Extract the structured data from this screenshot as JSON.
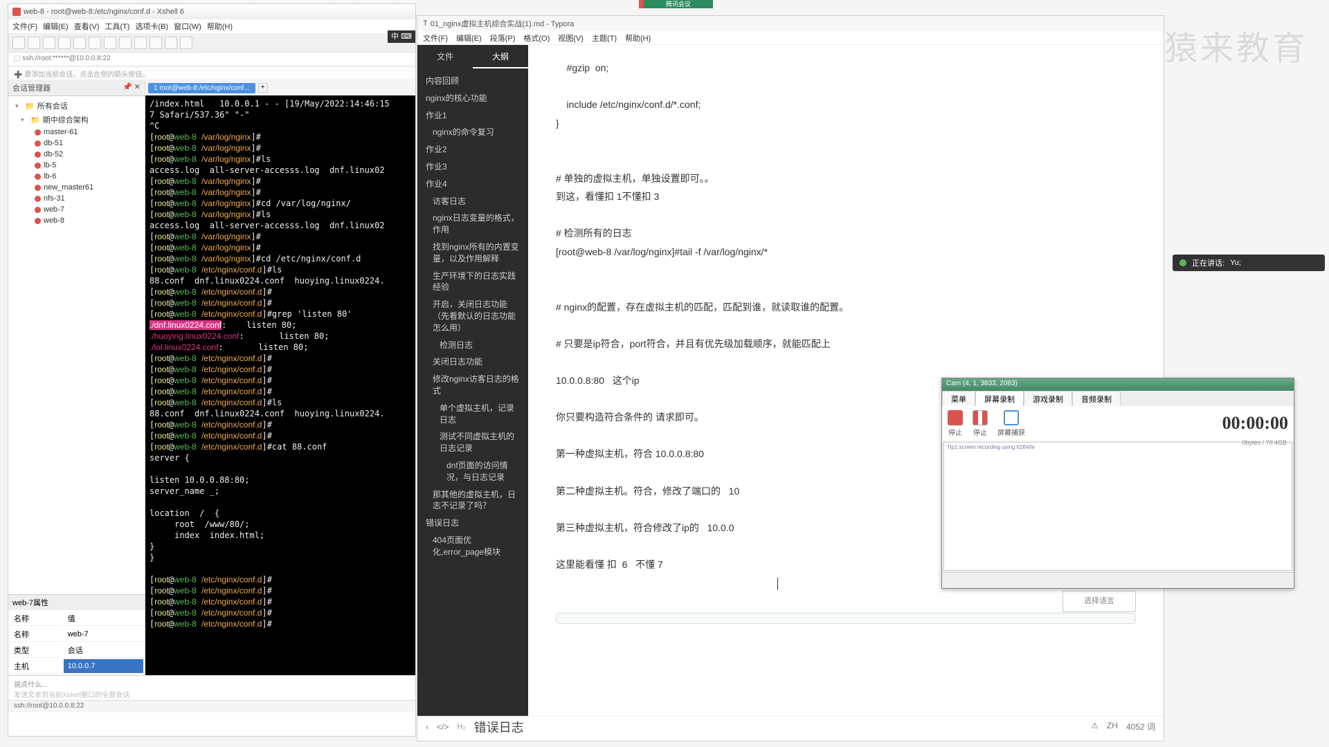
{
  "conference": {
    "label": "腾讯会议"
  },
  "watermark": "猿来教育",
  "speaking": {
    "prefix": "正在讲话:",
    "name": "Yu;"
  },
  "ime": "中 ⌨",
  "xshell": {
    "title": "web-8 - root@web-8:/etc/nginx/conf.d - Xshell 6",
    "menu": [
      "文件(F)",
      "编辑(E)",
      "查看(V)",
      "工具(T)",
      "选项卡(B)",
      "窗口(W)",
      "帮助(H)"
    ],
    "ssh_line": "⬚ ssh://root:******@10.0.0.8:22",
    "tip": "➕ 要添加当前会话，点击左侧的箭头按钮。",
    "session_mgr": "会话管理器",
    "tree": {
      "root": "所有会话",
      "folder": "期中综合架构",
      "items": [
        "master-61",
        "db-51",
        "db-52",
        "lb-5",
        "lb-6",
        "new_master61",
        "nfs-31",
        "web-7",
        "web-8"
      ]
    },
    "props": {
      "title": "web-7属性",
      "h_name": "名称",
      "h_val": "值",
      "r1k": "名称",
      "r1v": "web-7",
      "r2k": "类型",
      "r2v": "会话",
      "r3k": "主机",
      "r3v": "10.0.0.7"
    },
    "tab": "1 root@web-8:/etc/nginx/conf...",
    "terminal": "/index.html   10.0.0.1 - - [19/May/2022:14:46:15\n7 Safari/537.36\" \"-\"\n^C\n[root@web-8 /var/log/nginx]#\n[root@web-8 /var/log/nginx]#\n[root@web-8 /var/log/nginx]#ls\naccess.log  all-server-accesss.log  dnf.linux02\n[root@web-8 /var/log/nginx]#\n[root@web-8 /var/log/nginx]#\n[root@web-8 /var/log/nginx]#cd /var/log/nginx/\n[root@web-8 /var/log/nginx]#ls\naccess.log  all-server-accesss.log  dnf.linux02\n[root@web-8 /var/log/nginx]#\n[root@web-8 /var/log/nginx]#\n[root@web-8 /var/log/nginx]#cd /etc/nginx/conf.d\n[root@web-8 /etc/nginx/conf.d]#ls\n88.conf  dnf.linux0224.conf  huoying.linux0224.\n[root@web-8 /etc/nginx/conf.d]#\n[root@web-8 /etc/nginx/conf.d]#\n[root@web-8 /etc/nginx/conf.d]#grep 'listen 80'\n./dnf.linux0224.conf:    listen 80;\n./huoying.linux0224.conf:       listen 80;\n./lol.linux0224.conf:       listen 80;\n[root@web-8 /etc/nginx/conf.d]#\n[root@web-8 /etc/nginx/conf.d]#\n[root@web-8 /etc/nginx/conf.d]#\n[root@web-8 /etc/nginx/conf.d]#\n[root@web-8 /etc/nginx/conf.d]#ls\n88.conf  dnf.linux0224.conf  huoying.linux0224.\n[root@web-8 /etc/nginx/conf.d]#\n[root@web-8 /etc/nginx/conf.d]#\n[root@web-8 /etc/nginx/conf.d]#cat 88.conf\nserver {\n\nlisten 10.0.0.88:80;\nserver_name _;\n\nlocation  /  {\n     root  /www/80/;\n     index  index.html;\n}\n}\n\n[root@web-8 /etc/nginx/conf.d]#\n[root@web-8 /etc/nginx/conf.d]#\n[root@web-8 /etc/nginx/conf.d]#\n[root@web-8 /etc/nginx/conf.d]#\n[root@web-8 /etc/nginx/conf.d]#",
    "bot_hint": "说点什么...",
    "bot_note": "发送文本到当前Xshell窗口的全部会话",
    "status": "ssh://root@10.0.0.8:22"
  },
  "typora": {
    "title": "01_nginx虚拟主机综合实战(1).md - Typora",
    "menu": [
      "文件(F)",
      "编辑(E)",
      "段落(P)",
      "格式(O)",
      "视图(V)",
      "主题(T)",
      "帮助(H)"
    ],
    "side_tabs": {
      "file": "文件",
      "outline": "大纲"
    },
    "outline": [
      {
        "l": "l1",
        "t": "内容回顾"
      },
      {
        "l": "l1",
        "t": "nginx的核心功能"
      },
      {
        "l": "l1",
        "t": "作业1"
      },
      {
        "l": "l2",
        "t": "nginx的命令复习"
      },
      {
        "l": "l1",
        "t": "作业2"
      },
      {
        "l": "l1",
        "t": "作业3"
      },
      {
        "l": "l1",
        "t": "作业4"
      },
      {
        "l": "l2",
        "t": "访客日志"
      },
      {
        "l": "l2",
        "t": "nginx日志变量的格式，作用"
      },
      {
        "l": "l2",
        "t": "找到nginx所有的内置变量，以及作用解释"
      },
      {
        "l": "l2",
        "t": "生产环境下的日志实践经验"
      },
      {
        "l": "l2",
        "t": "开启，关闭日志功能（先看默认的日志功能怎么用）"
      },
      {
        "l": "l3",
        "t": "检测日志"
      },
      {
        "l": "l2",
        "t": "关闭日志功能"
      },
      {
        "l": "l2",
        "t": "修改nginx访客日志的格式"
      },
      {
        "l": "l3",
        "t": "单个虚拟主机，记录日志"
      },
      {
        "l": "l3",
        "t": "测试不同虚拟主机的日志记录"
      },
      {
        "l": "l4",
        "t": "dnf页面的访问情况，与日志记录"
      },
      {
        "l": "l2",
        "t": "那其他的虚拟主机，日志不记录了吗？"
      },
      {
        "l": "l1",
        "t": "错误日志"
      },
      {
        "l": "l2",
        "t": "404页面优化,error_page模块"
      }
    ],
    "content": {
      "l1": "    #gzip  on;",
      "l2": "    include /etc/nginx/conf.d/*.conf;",
      "l3": "}",
      "l4": "# 单独的虚拟主机，单独设置即可。。",
      "l5": "到这，看懂扣 1不懂扣 3",
      "l6": "# 检测所有的日志",
      "l7": "[root@web-8 /var/log/nginx]#tail -f /var/log/nginx/*",
      "l8": "# nginx的配置，存在虚拟主机的匹配，匹配到谁，就读取谁的配置。",
      "l9": "# 只要是ip符合，port符合，并且有优先级加载顺序，就能匹配上",
      "l10": "10.0.0.8:80   这个ip",
      "l11": "你只要构造符合条件的 请求即可。",
      "l12": "第一种虚拟主机，符合 10.0.0.8:80",
      "l13": "第二种虚拟主机。符合，修改了端口的   10",
      "l14": "第三种虚拟主机，符合修改了ip的   10.0.0",
      "l15": "这里能看懂 扣  6   不懂 7"
    },
    "lang_placeholder": "选择语言",
    "foot": {
      "h2": "H₂",
      "title": "错误日志",
      "warn": "⚠",
      "zh": "ZH",
      "count": "4052 词"
    }
  },
  "ocam": {
    "title": "Cam (4, 1, 3833, 2083)",
    "tabs": [
      "菜单",
      "屏幕录制",
      "游戏录制",
      "音频录制"
    ],
    "btns": {
      "stop": "停止",
      "pause": "停止",
      "capture": "屏幕捕获"
    },
    "time": "00:00:00",
    "size": "0bytes / 70.4GB",
    "log": "Tip1:screen recording using h264/le"
  }
}
